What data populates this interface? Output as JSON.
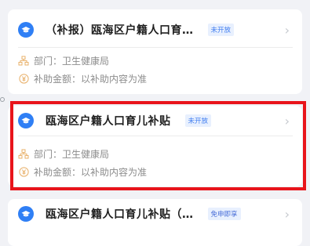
{
  "items": [
    {
      "title": "（补报）瓯海区户籍人口育…",
      "status": "未开放",
      "dept_label": "部门：",
      "dept": "卫生健康局",
      "amount_label": "补助金额：",
      "amount": "以补助内容为准"
    },
    {
      "title": "瓯海区户籍人口育儿补贴",
      "status": "未开放",
      "dept_label": "部门：",
      "dept": "卫生健康局",
      "amount_label": "补助金额：",
      "amount": "以补助内容为准"
    },
    {
      "title": "瓯海区户籍人口育儿补贴（…",
      "status": "免申即享"
    }
  ],
  "icons": {
    "service": "graduation-cap-icon",
    "dept": "org-chart-icon",
    "amount": "yuan-coin-icon",
    "arrow": "chevron-right-icon"
  },
  "colors": {
    "accent": "#2f7ff5",
    "highlight": "#e8141b"
  }
}
